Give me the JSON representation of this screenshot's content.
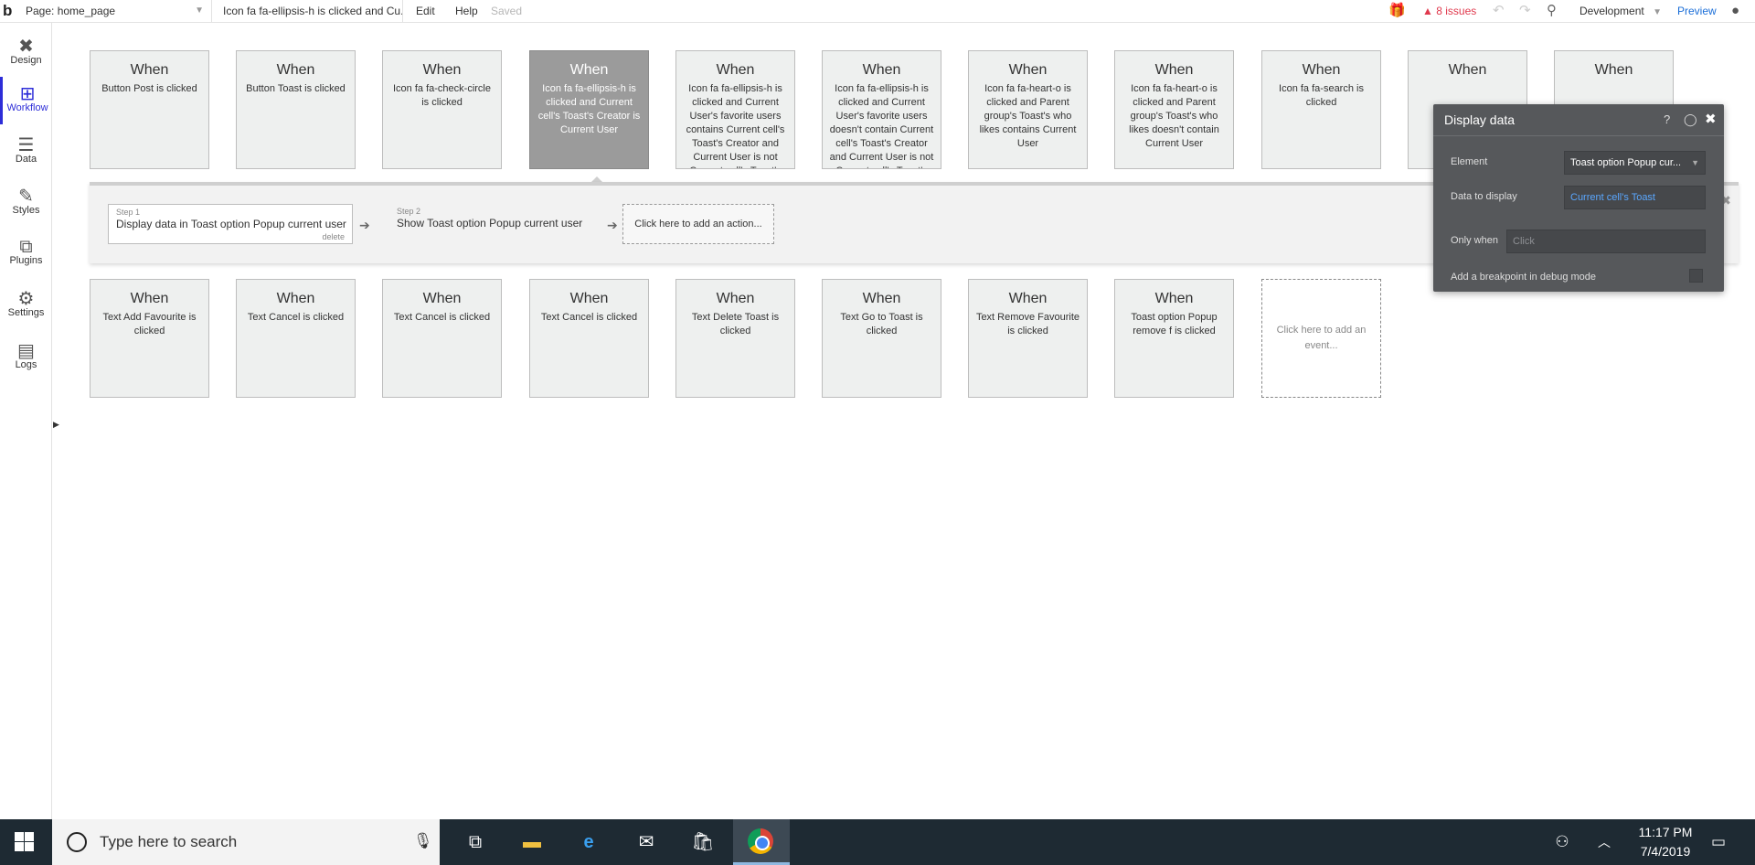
{
  "topbar": {
    "logo": "b",
    "page_label": "Page: home_page",
    "workflow_label": "Icon fa fa-ellipsis-h is clicked and Cu...",
    "menu_edit": "Edit",
    "menu_help": "Help",
    "saved": "Saved",
    "issues": "8 issues",
    "version": "Development",
    "preview": "Preview"
  },
  "nav": [
    {
      "label": "Design",
      "icon": "design-icon"
    },
    {
      "label": "Workflow",
      "icon": "workflow-icon"
    },
    {
      "label": "Data",
      "icon": "database-icon"
    },
    {
      "label": "Styles",
      "icon": "brush-icon"
    },
    {
      "label": "Plugins",
      "icon": "plugin-icon"
    },
    {
      "label": "Settings",
      "icon": "gear-icon"
    },
    {
      "label": "Logs",
      "icon": "log-icon"
    }
  ],
  "when_label": "When",
  "events_row1": [
    {
      "desc": "Button Post is clicked"
    },
    {
      "desc": "Button Toast is clicked"
    },
    {
      "desc": "Icon fa fa-check-circle is clicked"
    },
    {
      "desc": "Icon fa fa-ellipsis-h is clicked and Current cell's Toast's Creator is Current User"
    },
    {
      "desc": "Icon fa fa-ellipsis-h is clicked and Current User's favorite users contains Current cell's Toast's Creator and Current User is not Current cell's Toast's Creator"
    },
    {
      "desc": "Icon fa fa-ellipsis-h is clicked and Current User's favorite users doesn't contain Current cell's Toast's Creator and Current User is not Current cell's Toast's Creator"
    },
    {
      "desc": "Icon fa fa-heart-o is clicked and Parent group's Toast's who likes contains Current User"
    },
    {
      "desc": "Icon fa fa-heart-o is clicked and Parent group's Toast's who likes doesn't contain Current User"
    },
    {
      "desc": "Icon fa fa-search is clicked"
    },
    {
      "desc": ""
    },
    {
      "desc": ""
    }
  ],
  "events_row2": [
    {
      "desc": "Text Add Favourite is clicked"
    },
    {
      "desc": "Text Cancel is clicked"
    },
    {
      "desc": "Text Cancel is clicked"
    },
    {
      "desc": "Text Cancel is clicked"
    },
    {
      "desc": "Text Delete Toast is clicked"
    },
    {
      "desc": "Text Go to Toast is clicked"
    },
    {
      "desc": "Text Remove Favourite is clicked"
    },
    {
      "desc": "Toast option Popup remove f is clicked"
    }
  ],
  "add_event": "Click here to add an event...",
  "steps": {
    "step1_num": "Step 1",
    "step1_text": "Display data in Toast option Popup current user",
    "step1_delete": "delete",
    "step2_num": "Step 2",
    "step2_text": "Show Toast option Popup current user",
    "add_action": "Click here to add an action..."
  },
  "popup": {
    "title": "Display data",
    "element_label": "Element",
    "element_value": "Toast option Popup cur...",
    "data_label": "Data to display",
    "data_value": "Current cell's Toast",
    "only_when_label": "Only when",
    "only_when_placeholder": "Click",
    "breakpoint_label": "Add a breakpoint in debug mode"
  },
  "taskbar": {
    "search_placeholder": "Type here to search",
    "time": "11:17 PM",
    "date": "7/4/2019"
  },
  "colors": {
    "accent": "#2d2dd8",
    "issues": "#e0394d",
    "popup_bg": "#56585b",
    "selected_event": "#9b9b9b",
    "taskbar": "#1e2a33"
  }
}
